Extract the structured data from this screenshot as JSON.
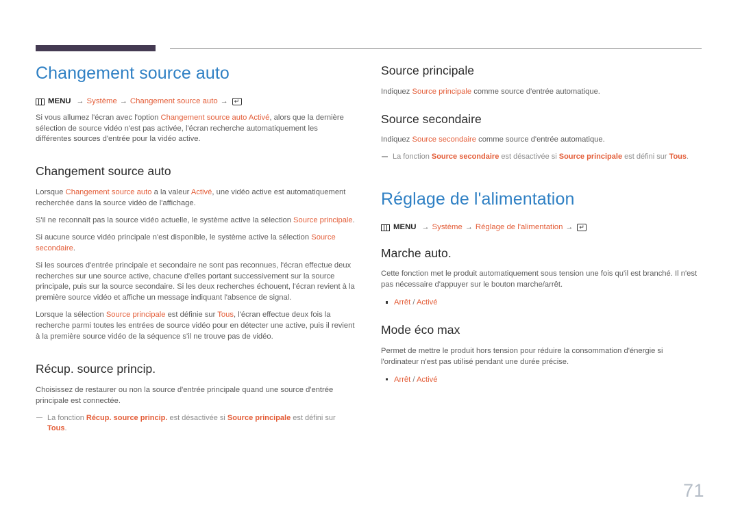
{
  "page": {
    "number": "71",
    "accent_blue": "#2f80c4",
    "accent_orange": "#e35c37",
    "header_bar_color": "#443a52",
    "body_text_color": "#5a5a5a",
    "note_text_color": "#8b8b8b"
  },
  "icons": {
    "menu_icon": "menu-grid-icon",
    "enter_icon": "enter-key-icon",
    "arrow": "→",
    "return_glyph": "↵"
  },
  "left_column": {
    "chapter_title": "Changement source auto",
    "menu_path": {
      "menu_label": "MENU",
      "items": [
        "Système",
        "Changement source auto"
      ]
    },
    "intro": {
      "part1": "Si vous allumez l'écran avec l'option ",
      "hl1": "Changement source auto Activé",
      "part2": ", alors que la dernière sélection de source vidéo n'est pas activée, l'écran recherche automatiquement les différentes sources d'entrée pour la vidéo active."
    },
    "sections": [
      {
        "heading": "Changement source auto",
        "paragraphs": [
          {
            "part1": "Lorsque ",
            "hl1": "Changement source auto",
            "part2": " a la valeur ",
            "hl2": "Activé",
            "part3": ", une vidéo active est automatiquement recherchée dans la source vidéo de l'affichage."
          },
          {
            "part1": "S'il ne reconnaît pas la source vidéo actuelle, le système active la sélection ",
            "hl1": "Source principale",
            "part2": "."
          },
          {
            "part1": "Si aucune source vidéo principale n'est disponible, le système active la sélection ",
            "hl1": "Source secondaire",
            "part2": "."
          },
          {
            "part1": "Si les sources d'entrée principale et secondaire ne sont pas reconnues, l'écran effectue deux recherches sur une source active, chacune d'elles portant successivement sur la source principale, puis sur la source secondaire. Si les deux recherches échouent, l'écran revient à la première source vidéo et affiche un message indiquant l'absence de signal."
          },
          {
            "part1": "Lorsque la sélection ",
            "hl1": "Source principale",
            "part2": " est définie sur ",
            "hl2": "Tous",
            "part3": ", l'écran effectue deux fois la recherche parmi toutes les entrées de source vidéo pour en détecter une active, puis il revient à la première source vidéo de la séquence s'il ne trouve pas de vidéo."
          }
        ]
      },
      {
        "heading": "Récup. source princip.",
        "body": "Choisissez de restaurer ou non la source d'entrée principale quand une source d'entrée principale est connectée.",
        "note": {
          "part1": "La fonction ",
          "hl1": "Récup. source princip.",
          "part2": " est désactivée si ",
          "hl2": "Source principale",
          "part3": " est défini sur ",
          "hl3": "Tous",
          "part4": "."
        }
      }
    ]
  },
  "right_column": {
    "sections_top": [
      {
        "heading": "Source principale",
        "body": {
          "part1": "Indiquez ",
          "hl1": "Source principale",
          "part2": " comme source d'entrée automatique."
        }
      },
      {
        "heading": "Source secondaire",
        "body": {
          "part1": "Indiquez ",
          "hl1": "Source secondaire",
          "part2": " comme source d'entrée automatique."
        },
        "note": {
          "part1": "La fonction ",
          "hl1": "Source secondaire",
          "part2": " est désactivée si ",
          "hl2": "Source principale",
          "part3": " est défini sur ",
          "hl3": "Tous",
          "part4": "."
        }
      }
    ],
    "chapter_title": "Réglage de l'alimentation",
    "menu_path": {
      "menu_label": "MENU",
      "items": [
        "Système",
        "Réglage de l'alimentation"
      ]
    },
    "sections_bottom": [
      {
        "heading": "Marche auto.",
        "body": "Cette fonction met le produit automatiquement sous tension une fois qu'il est branché. Il n'est pas nécessaire d'appuyer sur le bouton marche/arrêt.",
        "options": {
          "off": "Arrêt",
          "sep": " / ",
          "on": "Activé"
        }
      },
      {
        "heading": "Mode éco max",
        "body": "Permet de mettre le produit hors tension pour réduire la consommation d'énergie si l'ordinateur n'est pas utilisé pendant une durée précise.",
        "options": {
          "off": "Arrêt",
          "sep": " / ",
          "on": "Activé"
        }
      }
    ]
  }
}
